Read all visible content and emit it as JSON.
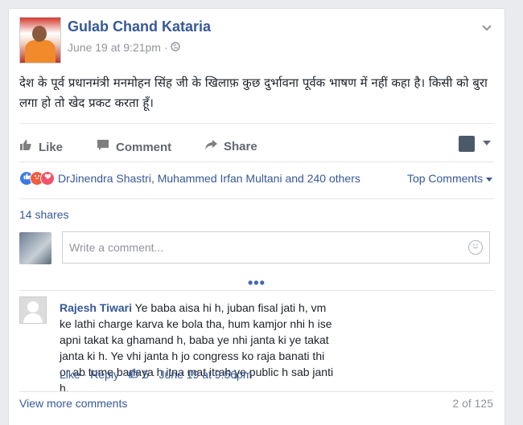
{
  "post": {
    "author": "Gulab Chand Kataria",
    "timestamp": "June 19 at 9:21pm",
    "meta_sep": "·",
    "text": "देश के पूर्व प्रधानमंत्री मनमोहन सिंह जी के खिलाफ़ कुछ दुर्भावना पूर्वक भाषण में नहीं कहा है। किसी को बुरा लगा हो तो खेद प्रकट करता हूँ।"
  },
  "actions": {
    "like": "Like",
    "comment": "Comment",
    "share": "Share"
  },
  "reactions": {
    "names": "DrJinendra Shastri, Muhammed Irfan Multani and 240 others",
    "top_comments": "Top Comments",
    "types": [
      "like",
      "angry",
      "love"
    ]
  },
  "shares": "14 shares",
  "composer": {
    "placeholder": "Write a comment..."
  },
  "more_dots": "•••",
  "comment": {
    "author": "Rajesh Tiwari",
    "text": "Ye baba aisa hi h, juban fisal jati h, vm ke lathi charge karva ke bola tha, hum kamjor nhi h ise apni takat ka ghamand h, baba ye nhi janta ki ye takat janta ki h. Ye vhi janta h jo congress ko raja banati thi or ab tume banaya h itna mat itrah ye public h sab janti h.",
    "like": "Like",
    "reply": "Reply",
    "sep": "·",
    "like_count": "5",
    "time": "June 19 at 9:56pm"
  },
  "footer": {
    "view_more": "View more comments",
    "count": "2 of 125"
  },
  "colors": {
    "link": "#365899",
    "muted": "#90949c",
    "like_blue": "#4267b2"
  },
  "icons": [
    "globe-icon",
    "chevron-down-icon",
    "like-icon",
    "comment-icon",
    "share-icon",
    "smiley-icon",
    "thumbs-up-icon"
  ]
}
